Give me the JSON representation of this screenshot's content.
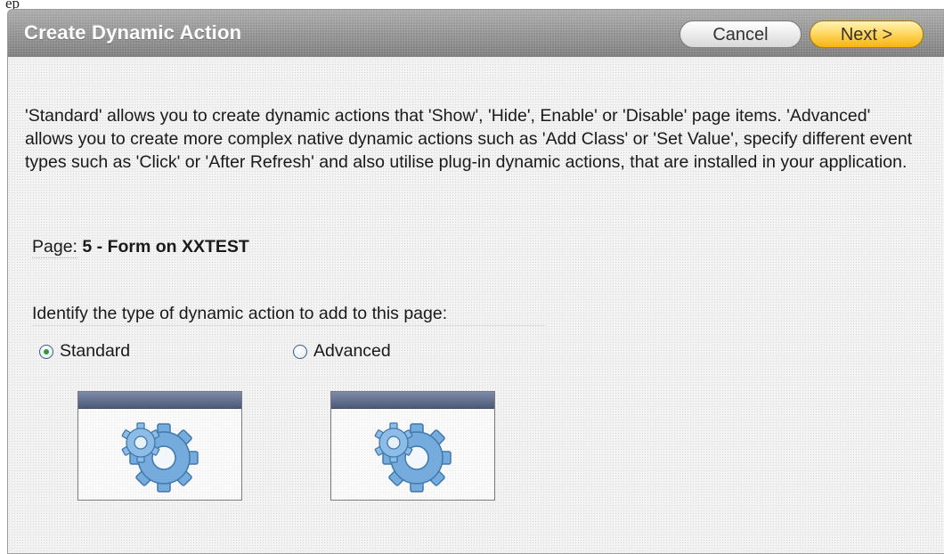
{
  "top_fragment": "ep",
  "wizard": {
    "title": "Create Dynamic Action",
    "cancel_label": "Cancel",
    "next_label": "Next >",
    "description": "'Standard' allows you to create dynamic actions that 'Show', 'Hide', Enable' or 'Disable' page items. 'Advanced' allows you to create more complex native dynamic actions such as 'Add Class' or 'Set Value', specify different event types such as 'Click' or 'After Refresh' and also utilise plug-in dynamic actions, that are installed in your application.",
    "page_label": "Page:",
    "page_value": "5 - Form on XXTEST",
    "prompt": "Identify the type of dynamic action to add to this page:",
    "options": [
      {
        "label": "Standard",
        "selected": true,
        "icon": "gear-icon"
      },
      {
        "label": "Advanced",
        "selected": false,
        "icon": "gear-icon"
      }
    ]
  },
  "colors": {
    "header": "#8d8d8d",
    "next_button": "#ffd55c",
    "radio_selected": "#2f9a35",
    "thumb_bar": "#5a6684",
    "gear": "#6fa6da"
  }
}
